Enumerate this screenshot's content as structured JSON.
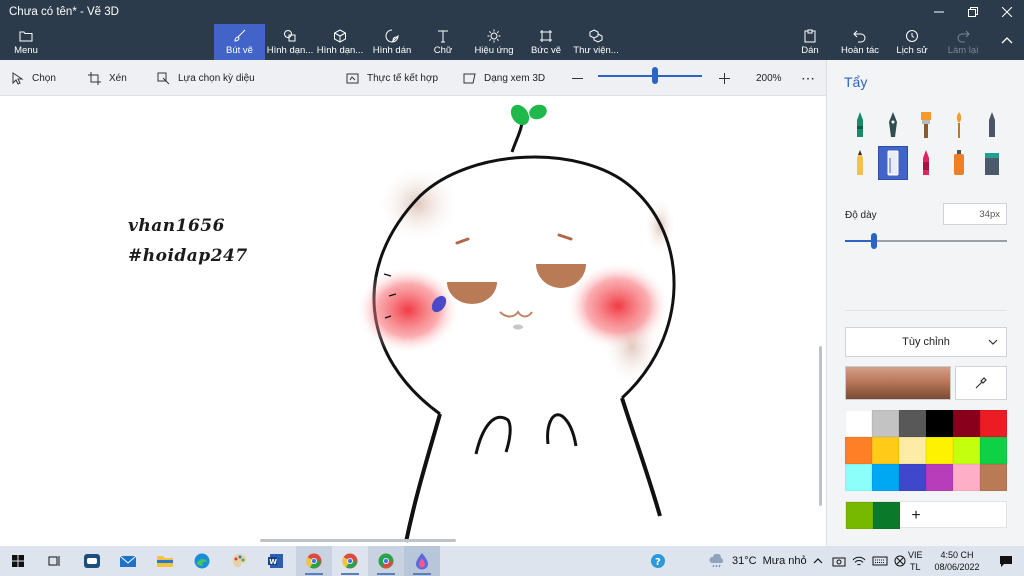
{
  "window": {
    "title": "Chưa có tên* - Vẽ 3D"
  },
  "toolbar": {
    "menu": "Menu",
    "brushes": "Bút vẽ",
    "shapes2d": "Hình dạn...",
    "shapes3d": "Hình dạn...",
    "stickers": "Hình dán",
    "text": "Chữ",
    "effects": "Hiệu ứng",
    "canvas": "Bức vẽ",
    "library": "Thư viện...",
    "paste": "Dán",
    "undo": "Hoàn tác",
    "history": "Lịch sử",
    "redo": "Làm lại"
  },
  "subtoolbar": {
    "select": "Chọn",
    "crop": "Xén",
    "magic_select": "Lựa chọn kỳ diệu",
    "mixed_reality": "Thực tế kết hợp",
    "view_3d": "Dạng xem 3D",
    "zoom_label": "200%",
    "zoom_level": 0.55
  },
  "canvas": {
    "text_line_1": "vhan1656",
    "text_line_2": "#hoidap247"
  },
  "panel": {
    "title": "Tẩy",
    "thickness_label": "Độ dày",
    "thickness_value": "34px",
    "thickness_level": 0.18,
    "dropdown_value": "Tùy chỉnh",
    "brushes": [
      "marker-icon",
      "calligraphy-pen-icon",
      "oil-brush-icon",
      "watercolor-icon",
      "pixel-pen-icon",
      "pencil-icon",
      "eraser-icon",
      "crayon-icon",
      "spray-can-icon",
      "fill-bucket-icon"
    ],
    "current_color": "#b9785a",
    "palette": [
      "#ffffff",
      "#c3c3c3",
      "#585858",
      "#000000",
      "#88001b",
      "#ec1c24",
      "#ff7f27",
      "#ffca18",
      "#fdeca6",
      "#fff200",
      "#c4ff0e",
      "#0ed145",
      "#8cfffb",
      "#00a8f3",
      "#3f48cc",
      "#b83dba",
      "#ffaec8",
      "#b97a56"
    ],
    "custom_colors": [
      "#76b900",
      "#0a7a2a"
    ]
  },
  "taskbar": {
    "weather_temp": "31°C",
    "weather_text": "Mưa nhỏ",
    "lang_top": "VIE",
    "lang_bottom": "TL",
    "time": "4:50 CH",
    "date": "08/06/2022"
  }
}
